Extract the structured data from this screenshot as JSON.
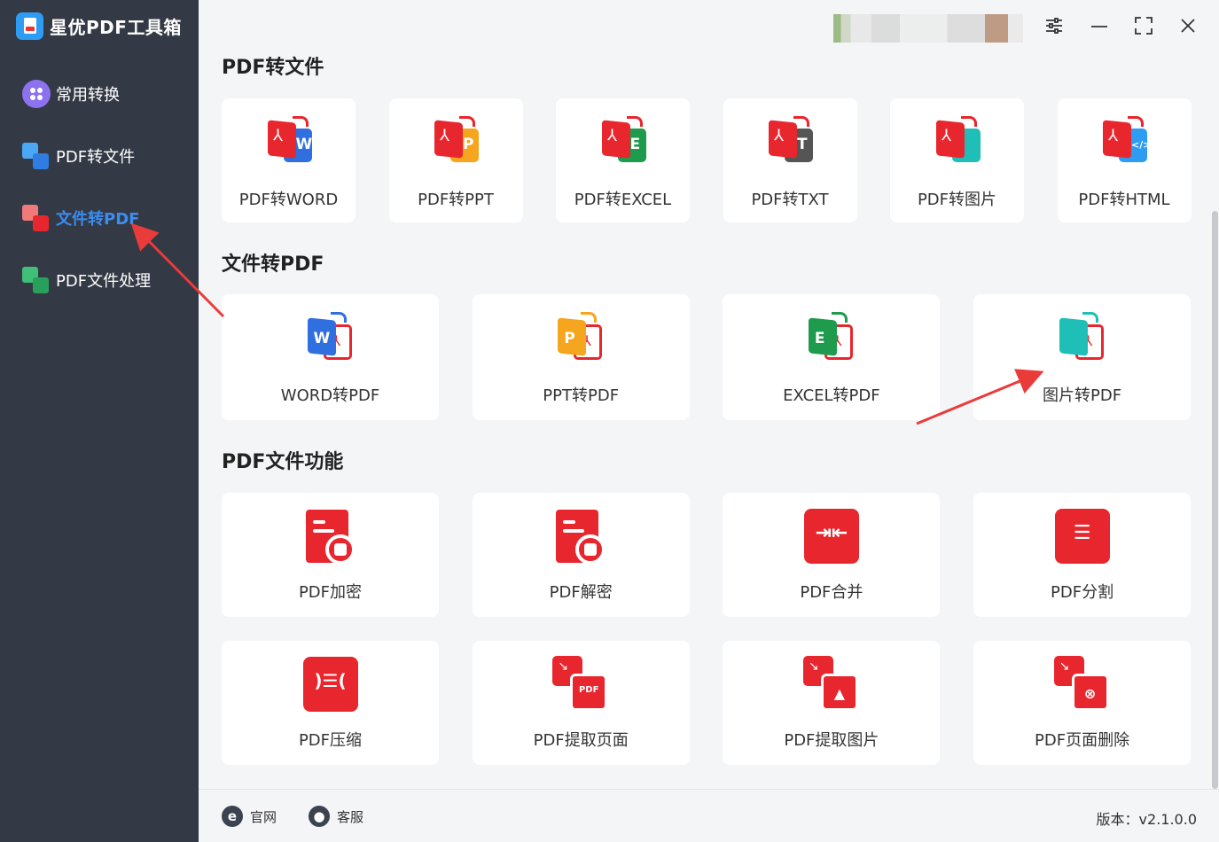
{
  "app": {
    "title": "星优PDF工具箱"
  },
  "sidebar": {
    "items": [
      {
        "label": "常用转换",
        "icon": "apps-grid-icon"
      },
      {
        "label": "PDF转文件",
        "icon": "pdf-to-file-icon"
      },
      {
        "label": "文件转PDF",
        "icon": "file-to-pdf-icon",
        "active": true
      },
      {
        "label": "PDF文件处理",
        "icon": "pdf-process-icon"
      }
    ]
  },
  "window_controls": [
    "settings-sliders-icon",
    "minimize-icon",
    "maximize-icon",
    "close-icon"
  ],
  "sections": {
    "pdf_to_file": {
      "title": "PDF转文件",
      "cards": [
        {
          "label": "PDF转WORD",
          "letter": "W",
          "color": "#2f6fe0"
        },
        {
          "label": "PDF转PPT",
          "letter": "P",
          "color": "#f5a51e"
        },
        {
          "label": "PDF转EXCEL",
          "letter": "E",
          "color": "#1f9b4d"
        },
        {
          "label": "PDF转TXT",
          "letter": "T",
          "color": "#555555"
        },
        {
          "label": "PDF转图片",
          "letter": "",
          "color": "#1fbfb8"
        },
        {
          "label": "PDF转HTML",
          "letter": "</>",
          "color": "#2f9cf3"
        }
      ]
    },
    "file_to_pdf": {
      "title": "文件转PDF",
      "cards": [
        {
          "label": "WORD转PDF",
          "letter": "W",
          "color": "#2f6fe0"
        },
        {
          "label": "PPT转PDF",
          "letter": "P",
          "color": "#f5a51e"
        },
        {
          "label": "EXCEL转PDF",
          "letter": "E",
          "color": "#1f9b4d"
        },
        {
          "label": "图片转PDF",
          "letter": "",
          "color": "#1fbfb8"
        }
      ]
    },
    "pdf_functions": {
      "title": "PDF文件功能",
      "cards": [
        {
          "label": "PDF加密",
          "icon": "pdf-lock-icon"
        },
        {
          "label": "PDF解密",
          "icon": "pdf-key-icon"
        },
        {
          "label": "PDF合并",
          "icon": "merge-icon"
        },
        {
          "label": "PDF分割",
          "icon": "split-icon"
        },
        {
          "label": "PDF压缩",
          "icon": "compress-icon"
        },
        {
          "label": "PDF提取页面",
          "icon": "extract-page-icon"
        },
        {
          "label": "PDF提取图片",
          "icon": "extract-image-icon"
        },
        {
          "label": "PDF页面删除",
          "icon": "delete-page-icon"
        }
      ]
    }
  },
  "footer": {
    "website": "官网",
    "support": "客服",
    "version": "版本：v2.1.0.0"
  },
  "colors": {
    "accent": "#3d8cf0",
    "brand_red": "#e8262e",
    "sidebar_bg": "#343a45"
  }
}
